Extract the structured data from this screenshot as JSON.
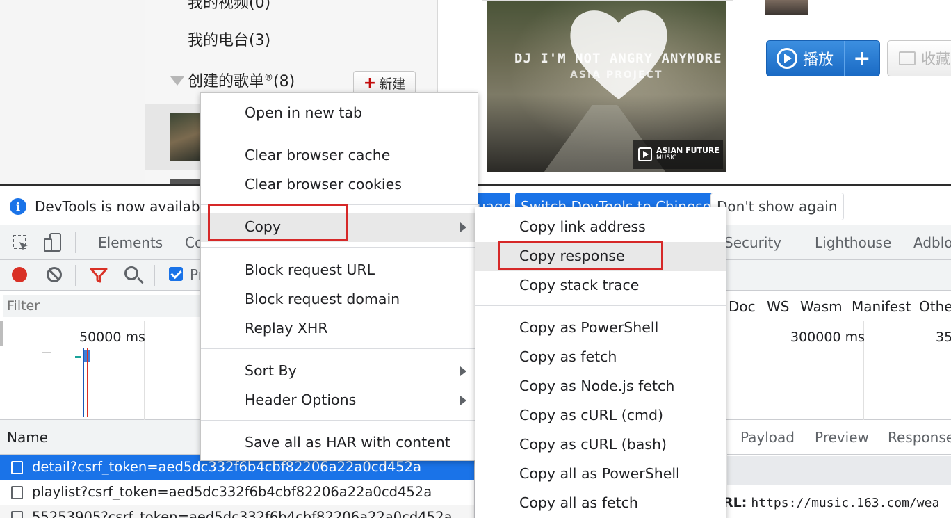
{
  "web": {
    "nav": {
      "item_top_partial": "我的视频(0)",
      "my_radio": "我的电台(3)",
      "created_playlists": "创建的歌单",
      "registered_mark": "®",
      "created_count": "(8)",
      "new_button": "新建",
      "new_plus": "+"
    },
    "cover": {
      "title": "DJ I'M NOT ANGRY ANYMORE",
      "subtitle": "ASIA PROJECT",
      "brand": "ASIAN FUTURE",
      "brand_sub": "MUSIC"
    },
    "actions": {
      "play_label": "播放",
      "add_label": "+",
      "favorite_label": "收藏"
    }
  },
  "devtools": {
    "infobar": {
      "message": "DevTools is now available",
      "btn_partial": "uage",
      "switch_button": "Switch DevTools to Chinese",
      "dont_show": "Don't show again"
    },
    "tabs": [
      "Elements",
      "Co",
      "Security",
      "Lighthouse",
      "Adblo"
    ],
    "toolbar": {
      "preserve_partial": "Pr"
    },
    "filter_placeholder": "Filter",
    "filter_types": [
      "Doc",
      "WS",
      "Wasm",
      "Manifest",
      "Othe"
    ],
    "overview_ticks": [
      "50000 ms",
      "300000 ms",
      "35"
    ],
    "requests": {
      "header": "Name",
      "rows": [
        "detail?csrf_token=aed5dc332f6b4cbf82206a22a0cd452a",
        "playlist?csrf_token=aed5dc332f6b4cbf82206a22a0cd452a",
        "55253905?csrf_token=aed5dc332f6b4cbf82206a22a0cd452a"
      ]
    },
    "details": {
      "tabs": [
        "Payload",
        "Preview",
        "Response"
      ],
      "url_label": "RL:",
      "url_value": "https://music.163.com/wea"
    }
  },
  "context_menu": {
    "items": [
      "Open in new tab",
      "Clear browser cache",
      "Clear browser cookies",
      "Copy",
      "Block request URL",
      "Block request domain",
      "Replay XHR",
      "Sort By",
      "Header Options",
      "Save all as HAR with content"
    ]
  },
  "copy_submenu": {
    "items": [
      "Copy link address",
      "Copy response",
      "Copy stack trace",
      "Copy as PowerShell",
      "Copy as fetch",
      "Copy as Node.js fetch",
      "Copy as cURL (cmd)",
      "Copy as cURL (bash)",
      "Copy all as PowerShell",
      "Copy all as fetch"
    ]
  },
  "colors": {
    "accent": "#1a73e8",
    "highlight_box": "#d62828",
    "record": "#d93025",
    "brand_red": "#c20c0c"
  }
}
